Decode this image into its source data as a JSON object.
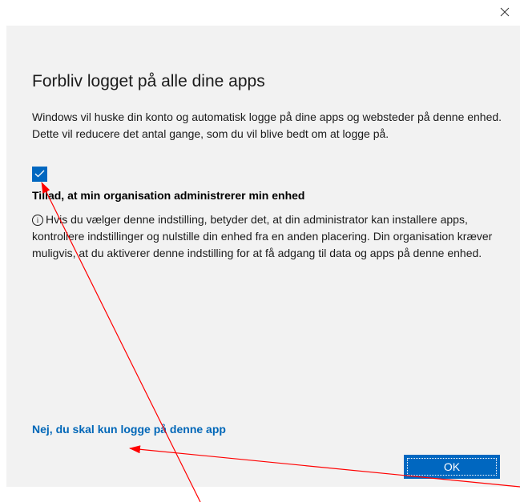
{
  "dialog": {
    "close_glyph": "✕",
    "title": "Forbliv logget på alle dine apps",
    "description": "Windows vil huske din konto og automatisk logge på dine apps og websteder på denne enhed. Dette vil reducere det antal gange, som du vil blive bedt om at logge på.",
    "checkbox": {
      "checked": true,
      "label": "Tillad, at min organisation administrerer min enhed"
    },
    "info_glyph": "i",
    "info_text": "Hvis du vælger denne indstilling, betyder det, at din administrator kan installere apps, kontrollere indstillinger og nulstille din enhed fra en anden placering. Din organisation kræver muligvis, at du aktiverer denne indstilling for at få adgang til data og apps på denne enhed.",
    "secondary_link": "Nej, du skal kun logge på denne app",
    "ok_label": "OK"
  },
  "colors": {
    "accent": "#0067c0",
    "link": "#0067b8",
    "panel": "#f2f2f2",
    "annotation_arrow": "#ff0000"
  }
}
